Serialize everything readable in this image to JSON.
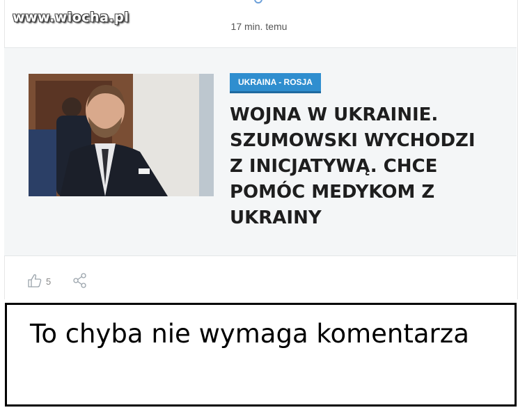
{
  "watermark": "www.wiocha.pl",
  "post": {
    "time": "17 min. temu"
  },
  "article": {
    "category": "UKRAINA - ROSJA",
    "headline": "WOJNA W UKRAINIE.\nSZUMOWSKI WYCHODZI\nZ INICJATYWĄ. CHCE\nPOMÓC MEDYKOM Z\nUKRAINY",
    "photo_icon": "photo-man-in-suit"
  },
  "actions": {
    "like_icon": "thumbs-up-icon",
    "likes": "5",
    "share_icon": "share-icon"
  },
  "caption": "To chyba nie wymaga komentarza",
  "colors": {
    "badge": "#2f8ecf",
    "headline": "#1e1e1e",
    "panel": "#f4f6f7"
  }
}
